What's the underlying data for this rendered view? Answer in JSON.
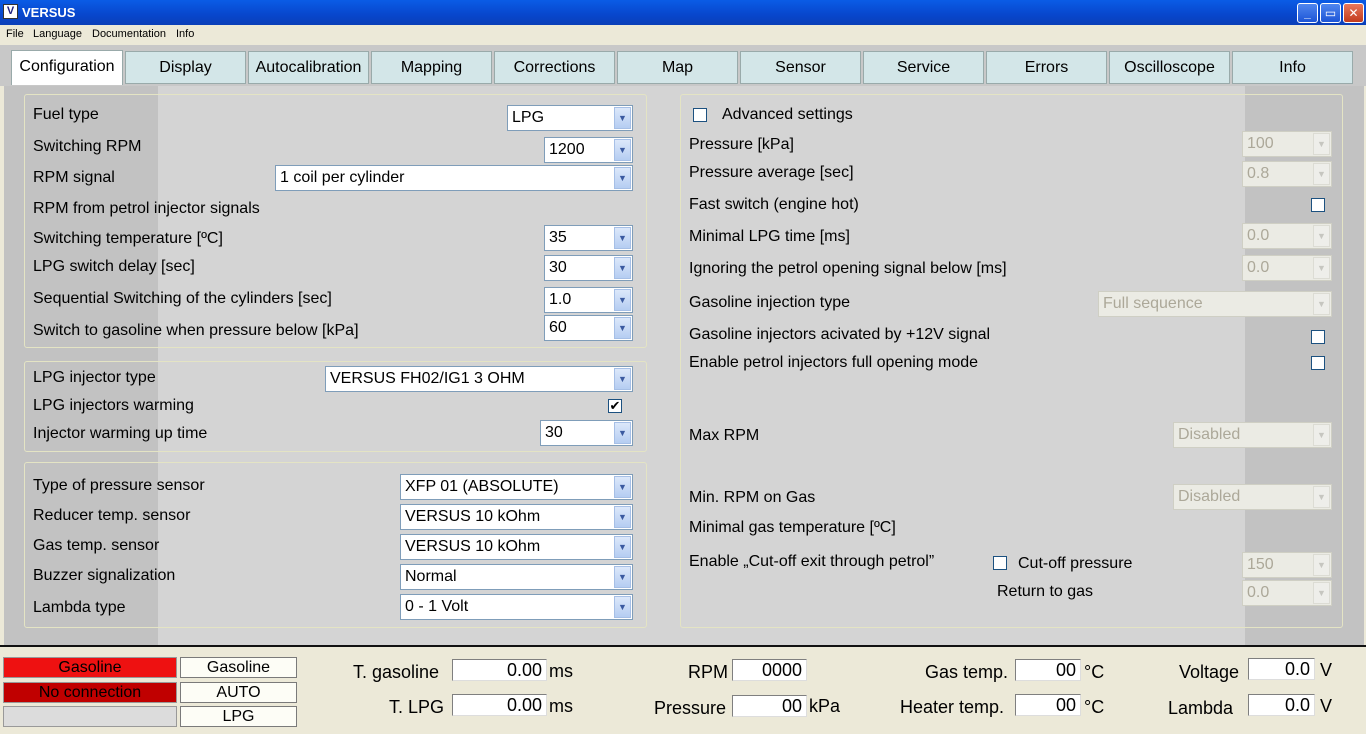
{
  "window": {
    "title": "VERSUS",
    "icon_letter": "V",
    "minimize": "_",
    "maximize": "▭",
    "close": "✕"
  },
  "menu": [
    "File",
    "Language",
    "Documentation",
    "Info"
  ],
  "tabs": [
    "Configuration",
    "Display",
    "Autocalibration",
    "Mapping",
    "Corrections",
    "Map",
    "Sensor",
    "Service",
    "Errors",
    "Oscilloscope",
    "Info"
  ],
  "active_tab": "Configuration",
  "left": {
    "fuel_type": {
      "label": "Fuel type",
      "value": "LPG"
    },
    "switching_rpm": {
      "label": "Switching RPM",
      "value": "1200"
    },
    "rpm_signal": {
      "label": "RPM signal",
      "value": "1 coil per cylinder"
    },
    "rpm_from_petrol": {
      "label": "RPM from petrol injector signals"
    },
    "switching_temp": {
      "label": "Switching temperature [ºC]",
      "value": "35"
    },
    "lpg_switch_delay": {
      "label": "LPG switch delay [sec]",
      "value": "30"
    },
    "sequential_switching": {
      "label": "Sequential Switching of the cylinders [sec]",
      "value": "1.0"
    },
    "switch_to_gasoline": {
      "label": "Switch to gasoline when pressure below [kPa]",
      "value": "60"
    },
    "lpg_injector_type": {
      "label": "LPG injector type",
      "value": "VERSUS FH02/IG1 3 OHM"
    },
    "lpg_injectors_warming": {
      "label": "LPG injectors warming",
      "checked": "✔"
    },
    "injector_warming_time": {
      "label": "Injector warming up time",
      "value": "30"
    },
    "pressure_sensor_type": {
      "label": "Type of pressure sensor",
      "value": "XFP 01 (ABSOLUTE)"
    },
    "reducer_temp_sensor": {
      "label": "Reducer temp. sensor",
      "value": "VERSUS 10 kOhm"
    },
    "gas_temp_sensor": {
      "label": "Gas temp. sensor",
      "value": "VERSUS 10 kOhm"
    },
    "buzzer": {
      "label": "Buzzer signalization",
      "value": "Normal"
    },
    "lambda_type": {
      "label": "Lambda type",
      "value": "0 - 1 Volt"
    }
  },
  "right": {
    "advanced": {
      "label": "Advanced settings"
    },
    "pressure": {
      "label": "Pressure [kPa]",
      "value": "100"
    },
    "pressure_avg": {
      "label": "Pressure average [sec]",
      "value": "0.8"
    },
    "fast_switch": {
      "label": "Fast switch (engine hot)"
    },
    "min_lpg_time": {
      "label": "Minimal LPG time [ms]",
      "value": "0.0"
    },
    "ignore_petrol": {
      "label": "Ignoring the petrol opening signal below  [ms]",
      "value": "0.0"
    },
    "gasoline_inj_type": {
      "label": "Gasoline injection type",
      "value": "Full sequence"
    },
    "gasoline_12v": {
      "label": "Gasoline injectors acivated by +12V signal"
    },
    "petrol_full_open": {
      "label": "Enable petrol injectors full opening mode"
    },
    "max_rpm": {
      "label": "Max RPM",
      "value": "Disabled"
    },
    "min_rpm_gas": {
      "label": "Min. RPM on Gas",
      "value": "Disabled"
    },
    "min_gas_temp": {
      "label": "Minimal gas temperature [ºC]"
    },
    "cutoff_exit": {
      "label": "Enable „Cut-off exit through petrol”"
    },
    "cutoff_pressure": {
      "label": "Cut-off pressure",
      "value": "150"
    },
    "return_to_gas": {
      "label": "Return to gas",
      "value": "0.0"
    }
  },
  "status": {
    "gasoline_indicator": "Gasoline",
    "connection_indicator": "No connection",
    "btn_gasoline": "Gasoline",
    "btn_auto": "AUTO",
    "btn_lpg": "LPG",
    "t_gasoline": {
      "label": "T. gasoline",
      "value": "0.00",
      "unit": "ms"
    },
    "t_lpg": {
      "label": "T. LPG",
      "value": "0.00",
      "unit": "ms"
    },
    "rpm": {
      "label": "RPM",
      "value": "0000"
    },
    "pressure": {
      "label": "Pressure",
      "value": "00",
      "unit": "kPa"
    },
    "gas_temp": {
      "label": "Gas temp.",
      "value": "00",
      "unit": "°C"
    },
    "heater_temp": {
      "label": "Heater temp.",
      "value": "00",
      "unit": "°C"
    },
    "voltage": {
      "label": "Voltage",
      "value": "0.0",
      "unit": "V"
    },
    "lambda": {
      "label": "Lambda",
      "value": "0.0",
      "unit": "V"
    }
  },
  "colors": {
    "indicator_red": "#ee1111",
    "indicator_dark_red": "#c00000",
    "tab_bg": "#d3e6e8",
    "title_blue": "#0846cc"
  }
}
